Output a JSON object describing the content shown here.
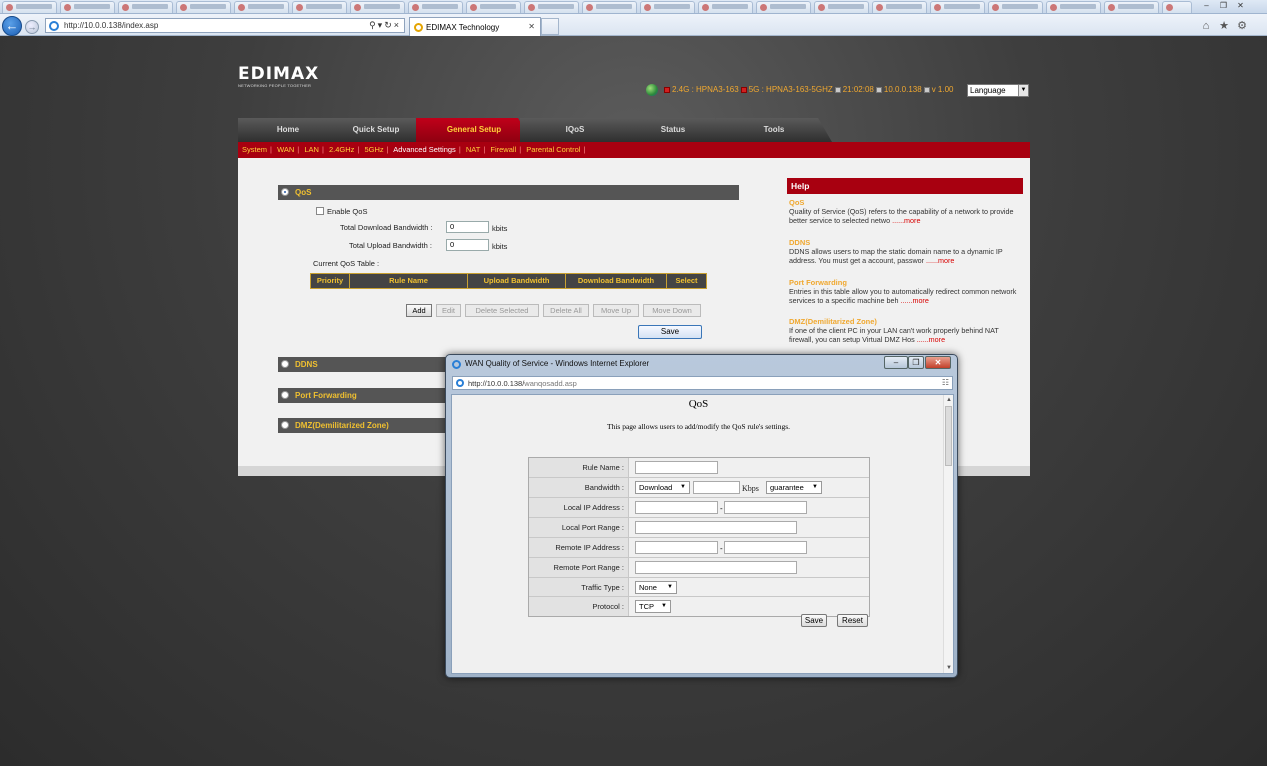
{
  "browser": {
    "address_url": "http://10.0.0.138/index.asp",
    "tab_title": "EDIMAX Technology"
  },
  "router": {
    "logo": "EDIMAX",
    "logo_sub": "NETWORKING PEOPLE TOGETHER",
    "status": {
      "band24": "2.4G",
      "ssid24": "HPNA3-163",
      "band5": "5G",
      "ssid5": "HPNA3-163-5GHZ",
      "time": "21:02:08",
      "ip": "10.0.0.138",
      "version": "v 1.00"
    },
    "language": "Language",
    "main_tabs": [
      "Home",
      "Quick Setup",
      "General Setup",
      "IQoS",
      "Status",
      "Tools"
    ],
    "sub_menu": [
      "System",
      "WAN",
      "LAN",
      "2.4GHz",
      "5GHz",
      "Advanced Settings",
      "NAT",
      "Firewall",
      "Parental Control"
    ],
    "qos": {
      "title": "QoS",
      "enable_label": "Enable QoS",
      "download_label": "Total Download Bandwidth :",
      "download_value": "0",
      "upload_label": "Total Upload Bandwidth :",
      "upload_value": "0",
      "unit": "kbits",
      "table_title": "Current QoS Table :",
      "columns": [
        "Priority",
        "Rule Name",
        "Upload Bandwidth",
        "Download Bandwidth",
        "Select"
      ],
      "buttons": [
        "Add",
        "Edit",
        "Delete Selected",
        "Delete All",
        "Move Up",
        "Move Down"
      ],
      "save": "Save"
    },
    "sections": [
      "DDNS",
      "Port Forwarding",
      "DMZ(Demilitarized Zone)"
    ],
    "help": {
      "title": "Help",
      "items": [
        {
          "h": "QoS",
          "p": "Quality of Service (QoS) refers to the capability of a network to provide better service to selected netwo"
        },
        {
          "h": "DDNS",
          "p": "DDNS allows users to map the static domain name to a dynamic IP address. You must get a account, passwor"
        },
        {
          "h": "Port Forwarding",
          "p": "Entries in this table allow you to automatically redirect common network services to a specific machine beh"
        },
        {
          "h": "DMZ(Demilitarized Zone)",
          "p": "If one of the client PC in your LAN can't work properly behind NAT firewall, you can setup Virtual DMZ Hos"
        }
      ],
      "more": "......more"
    }
  },
  "popup": {
    "title": "WAN Quality of Service - Windows Internet Explorer",
    "url_host": "http://10.0.0.138/",
    "url_path": "wanqosadd.asp",
    "heading": "QoS",
    "description": "This page allows users to add/modify the QoS rule's settings.",
    "fields": {
      "rule_name": "Rule Name :",
      "bandwidth": "Bandwidth :",
      "local_ip": "Local IP Address :",
      "local_port": "Local Port Range :",
      "remote_ip": "Remote IP Address :",
      "remote_port": "Remote Port Range :",
      "traffic_type": "Traffic Type :",
      "protocol": "Protocol :"
    },
    "bandwidth_dir": "Download",
    "bandwidth_unit": "Kbps",
    "bandwidth_mode": "guarantee",
    "traffic_type_value": "None",
    "protocol_value": "TCP",
    "save": "Save",
    "reset": "Reset"
  }
}
